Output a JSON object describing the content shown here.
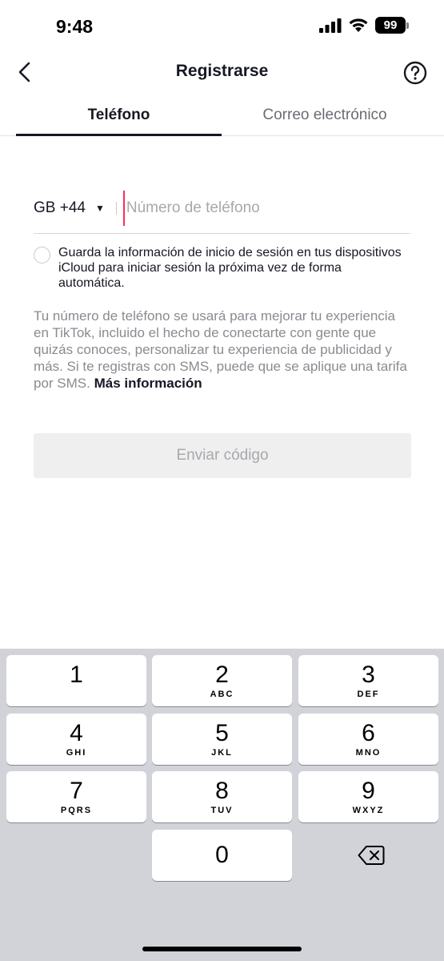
{
  "status_bar": {
    "time": "9:48",
    "battery": "99"
  },
  "nav": {
    "title": "Registrarse"
  },
  "tabs": [
    {
      "label": "Teléfono",
      "active": true
    },
    {
      "label": "Correo electrónico",
      "active": false
    }
  ],
  "phone": {
    "country_code": "GB +44",
    "placeholder": "Número de teléfono",
    "value": ""
  },
  "save_login": {
    "text": "Guarda la información de inicio de sesión en tus dispositivos iCloud para iniciar sesión la próxima vez de forma automática."
  },
  "info": {
    "text": "Tu número de teléfono se usará para mejorar tu experiencia en TikTok, incluido el hecho de conectarte con gente que quizás conoces, personalizar tu experiencia de publicidad y más. Si te registras con SMS, puede que se aplique una tarifa por SMS.",
    "link": "Más información"
  },
  "send_button": {
    "label": "Enviar código"
  },
  "keypad": {
    "keys": [
      {
        "num": "1",
        "letters": ""
      },
      {
        "num": "2",
        "letters": "ABC"
      },
      {
        "num": "3",
        "letters": "DEF"
      },
      {
        "num": "4",
        "letters": "GHI"
      },
      {
        "num": "5",
        "letters": "JKL"
      },
      {
        "num": "6",
        "letters": "MNO"
      },
      {
        "num": "7",
        "letters": "PQRS"
      },
      {
        "num": "8",
        "letters": "TUV"
      },
      {
        "num": "9",
        "letters": "WXYZ"
      },
      {
        "num": "0",
        "letters": ""
      }
    ]
  },
  "colors": {
    "accent": "#fe2c55",
    "text": "#161823",
    "muted": "#8a8b91",
    "keypad_bg": "#d1d3d9"
  }
}
